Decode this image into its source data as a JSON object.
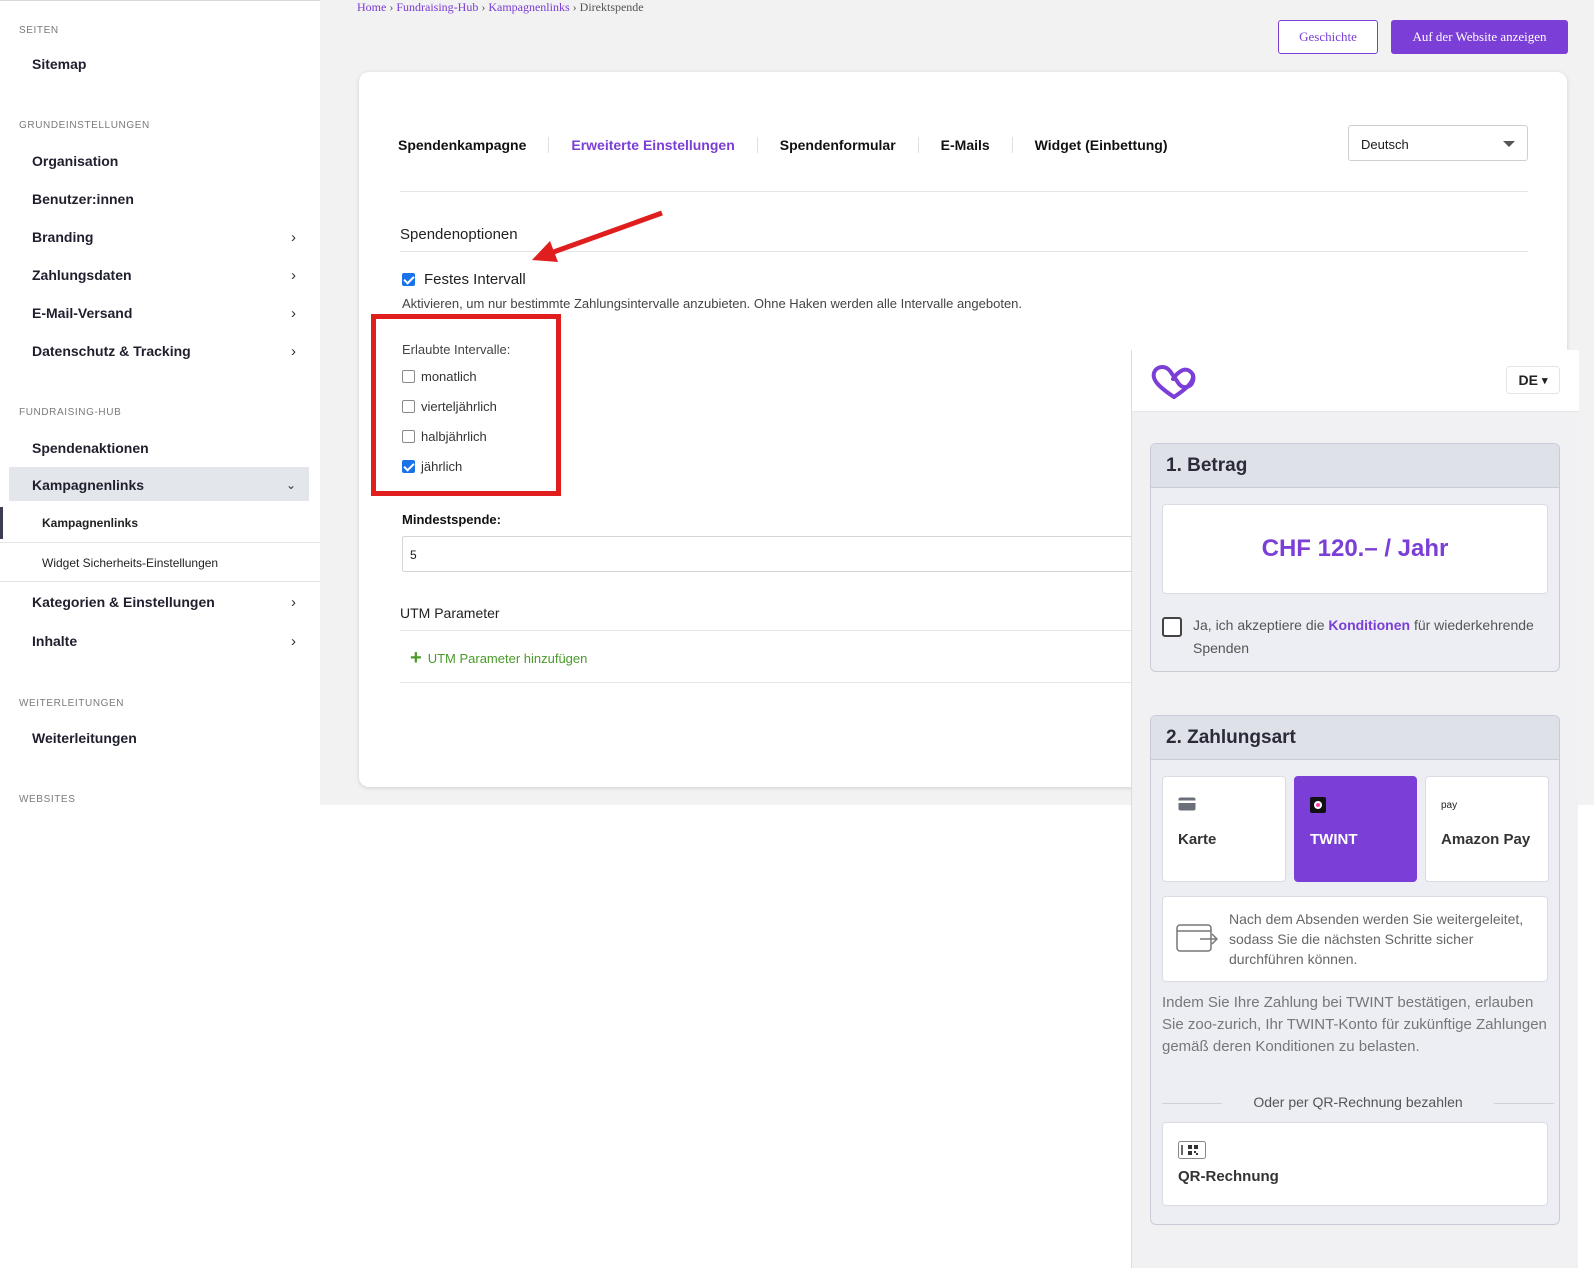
{
  "sidebar": {
    "sections": {
      "pages": "SEITEN",
      "basic": "GRUNDEINSTELLUNGEN",
      "hub": "FUNDRAISING-HUB",
      "redirects": "WEITERLEITUNGEN",
      "websites": "WEBSITES"
    },
    "items": {
      "sitemap": "Sitemap",
      "organisation": "Organisation",
      "users": "Benutzer:innen",
      "branding": "Branding",
      "payment": "Zahlungsdaten",
      "email": "E-Mail-Versand",
      "privacy": "Datenschutz & Tracking",
      "campaigns": "Spendenaktionen",
      "campaignlinks": "Kampagnenlinks",
      "sub_campaignlinks": "Kampagnenlinks",
      "sub_widget_security": "Widget Sicherheits-Einstellungen",
      "categories": "Kategorien & Einstellungen",
      "contents": "Inhalte",
      "redirects": "Weiterleitungen"
    }
  },
  "breadcrumb": {
    "home": "Home",
    "hub": "Fundraising-Hub",
    "links": "Kampagnenlinks",
    "current": "Direktspende",
    "sep": "›"
  },
  "header": {
    "history_btn": "Geschichte",
    "view_btn": "Auf der Website anzeigen"
  },
  "tabs": [
    "Spendenkampagne",
    "Erweiterte Einstellungen",
    "Spendenformular",
    "E-Mails",
    "Widget (Einbettung)"
  ],
  "language_select": "Deutsch",
  "form": {
    "section_options": "Spendenoptionen",
    "fixed_interval_label": "Festes Intervall",
    "fixed_interval_checked": true,
    "help": "Aktivieren, um nur bestimmte Zahlungsintervalle anzubieten. Ohne Haken werden alle Intervalle angeboten.",
    "allowed_label": "Erlaubte Intervalle:",
    "intervals": [
      {
        "label": "monatlich",
        "checked": false
      },
      {
        "label": "vierteljährlich",
        "checked": false
      },
      {
        "label": "halbjährlich",
        "checked": false
      },
      {
        "label": "jährlich",
        "checked": true
      }
    ],
    "min_label": "Mindestspende:",
    "min_value": "5",
    "utm_title": "UTM Parameter",
    "utm_add": "UTM Parameter hinzufügen"
  },
  "widget": {
    "lang": "DE",
    "step1": "1. Betrag",
    "amount": "CHF 120.– / Jahr",
    "terms_pre": "Ja, ich akzeptiere die ",
    "terms_link": "Konditionen",
    "terms_post": " für wiederkehrende Spenden",
    "step2": "2. Zahlungsart",
    "pay_card": "Karte",
    "pay_twint": "TWINT",
    "pay_amazon": "Amazon Pay",
    "amazon_small": "pay",
    "redirect_info": "Nach dem Absenden werden Sie weitergeleitet, sodass Sie die nächsten Schritte sicher durchführen können.",
    "twint_note": "Indem Sie Ihre Zahlung bei TWINT bestätigen, erlauben Sie zoo-zurich, Ihr TWINT-Konto für zukünftige Zahlungen gemäß deren Konditionen zu belasten.",
    "or_qr": "Oder per QR-Rechnung bezahlen",
    "qr": "QR-Rechnung"
  },
  "colors": {
    "accent": "#7b3ed6",
    "annotation": "#e01e1e",
    "add_link": "#4a9a2a"
  }
}
